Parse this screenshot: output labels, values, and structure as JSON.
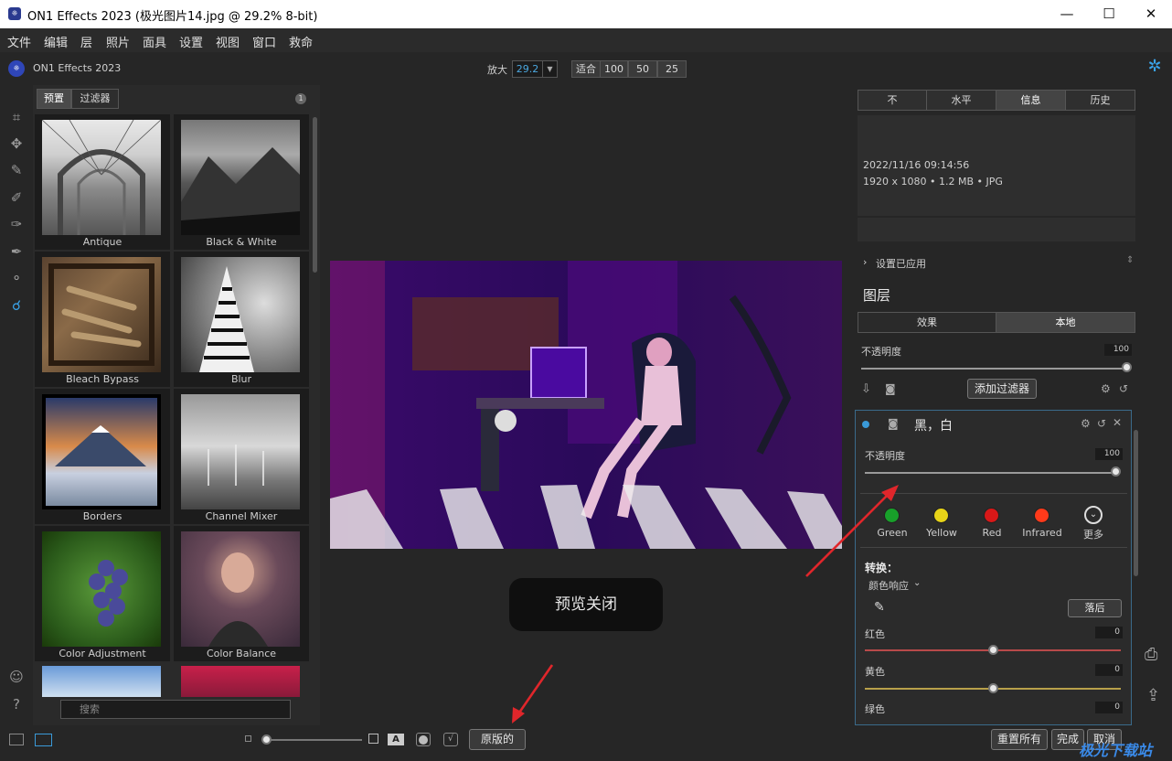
{
  "window": {
    "title": "ON1 Effects 2023 (极光图片14.jpg @ 29.2% 8-bit)",
    "minimize": "—",
    "maximize": "☐",
    "close": "✕"
  },
  "menu": [
    "文件",
    "编辑",
    "层",
    "照片",
    "面具",
    "设置",
    "视图",
    "窗口",
    "救命"
  ],
  "header": {
    "app_name": "ON1 Effects 2023",
    "zoom_label": "放大",
    "zoom_value": "29.2",
    "zoom_buttons": [
      "适合",
      "100",
      "50",
      "25"
    ]
  },
  "browser": {
    "tabs": [
      "预置",
      "过滤器"
    ],
    "badge": "1",
    "presets": [
      "Antique",
      "Black & White",
      "Bleach Bypass",
      "Blur",
      "Borders",
      "Channel Mixer",
      "Color Adjustment",
      "Color Balance"
    ],
    "search_placeholder": "搜索"
  },
  "preview": {
    "message": "预览关闭"
  },
  "right": {
    "tabs": [
      "不",
      "水平",
      "信息",
      "历史"
    ],
    "active_tab": "信息",
    "date": "2022/11/16  09:14:56",
    "meta": "1920 x 1080 • 1.2 MB • JPG",
    "settings_applied": "设置已应用",
    "layers_title": "图层",
    "layer_tabs": [
      "效果",
      "本地"
    ],
    "opacity_label": "不透明度",
    "opacity_value": "100",
    "add_filter": "添加过滤器",
    "filter": {
      "name": "黑，白",
      "opacity_label": "不透明度",
      "opacity_value": "100",
      "presets": [
        {
          "label": "Green",
          "color": "#18a02a"
        },
        {
          "label": "Yellow",
          "color": "#e8d418"
        },
        {
          "label": "Red",
          "color": "#d81818"
        },
        {
          "label": "Infrared",
          "color": "#ff3a1a"
        }
      ],
      "more": "更多",
      "convert_label": "转换：",
      "color_response": "颜色响应",
      "reset_btn": "落后",
      "channels": [
        {
          "label": "红色",
          "value": "0",
          "color": "#b84a4a"
        },
        {
          "label": "黄色",
          "value": "0",
          "color": "#b8a04a"
        },
        {
          "label": "绿色",
          "value": "0",
          "color": "#4ab84a"
        }
      ]
    }
  },
  "bottom": {
    "original_btn": "原版的",
    "reset_all": "重置所有",
    "done": "完成",
    "cancel": "取消"
  },
  "watermark": "极光下载站"
}
